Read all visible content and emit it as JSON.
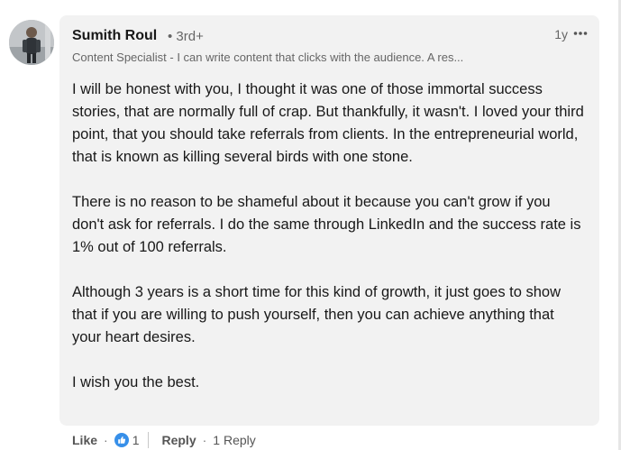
{
  "comment": {
    "author": "Sumith Roul",
    "degree": "• 3rd+",
    "timestamp": "1y",
    "headline": "Content Specialist - I can write content that clicks with the audience. A res...",
    "paragraphs": [
      "I will be honest with you, I thought it was one of those immortal success stories, that are normally full of crap. But thankfully, it wasn't. I loved your third point, that you should take referrals from clients. In the entrepreneurial world, that is known as killing several birds with one stone.",
      "There is no reason to be shameful about it because you can't grow if you don't ask for referrals. I do the same through LinkedIn and the success rate is 1% out of 100 referrals.",
      "Although 3 years is a short time for this kind of growth, it just goes to show that if you are willing to push yourself, then you can achieve anything that your heart desires.",
      "I wish you the best."
    ]
  },
  "actions": {
    "like_label": "Like",
    "separator": "·",
    "reaction_count": "1",
    "reply_label": "Reply",
    "replies_label": "1 Reply"
  },
  "icons": {
    "avatar": "avatar",
    "more": "ellipsis-icon",
    "reaction": "thumbs-up-icon"
  },
  "colors": {
    "bubble": "#f2f2f2",
    "like_blue": "#378fe9",
    "secondary_text": "#666666"
  }
}
